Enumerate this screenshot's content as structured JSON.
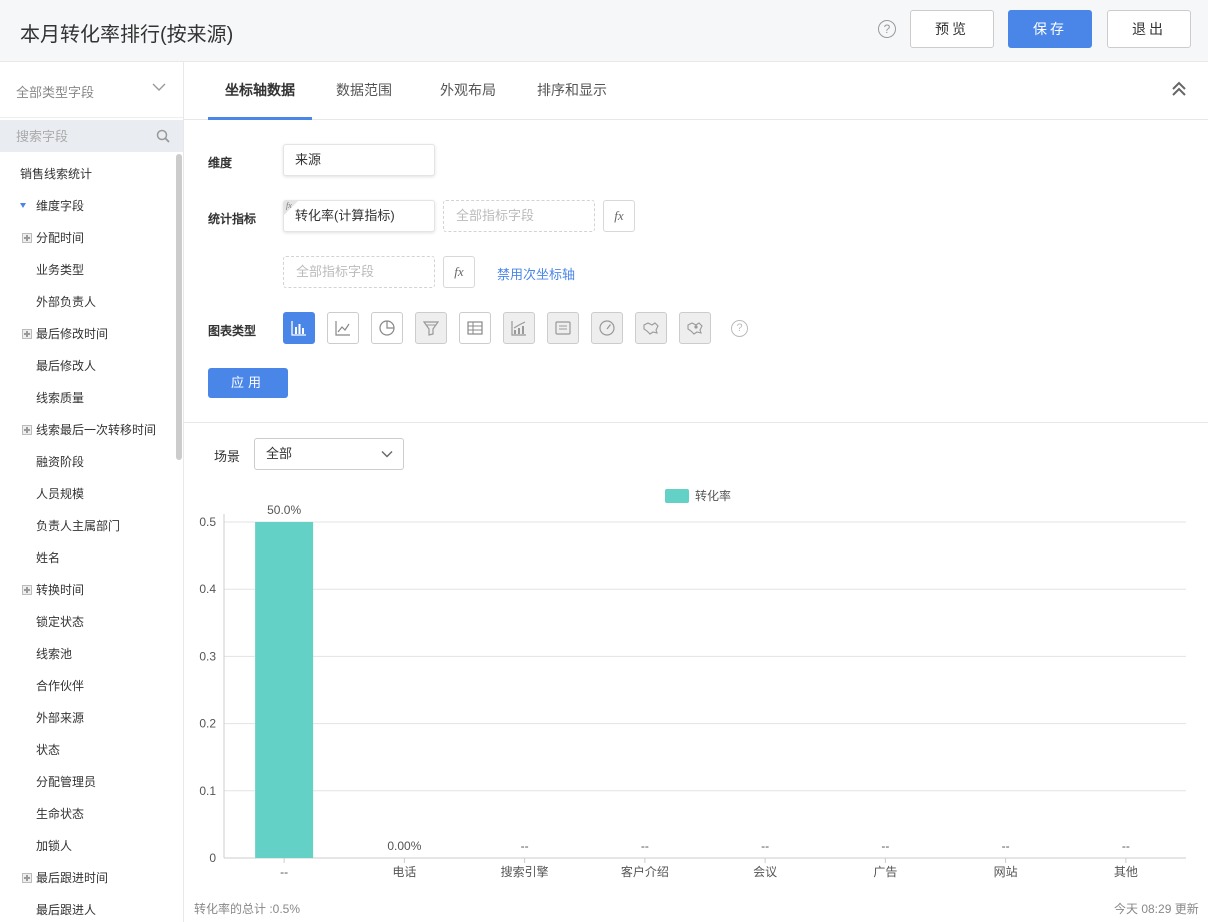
{
  "header": {
    "title": "本月转化率排行(按来源)",
    "help": "?",
    "preview_label": "预览",
    "save_label": "保存",
    "exit_label": "退出"
  },
  "sidebar": {
    "type_select": "全部类型字段",
    "search_placeholder": "搜索字段",
    "items": [
      {
        "label": "销售线索统计",
        "kind": "root"
      },
      {
        "label": "维度字段",
        "kind": "group"
      },
      {
        "label": "分配时间",
        "kind": "expandable"
      },
      {
        "label": "业务类型",
        "kind": "leaf"
      },
      {
        "label": "外部负责人",
        "kind": "leaf"
      },
      {
        "label": "最后修改时间",
        "kind": "expandable"
      },
      {
        "label": "最后修改人",
        "kind": "leaf"
      },
      {
        "label": "线索质量",
        "kind": "leaf"
      },
      {
        "label": "线索最后一次转移时间",
        "kind": "expandable"
      },
      {
        "label": "融资阶段",
        "kind": "leaf"
      },
      {
        "label": "人员规模",
        "kind": "leaf"
      },
      {
        "label": "负责人主属部门",
        "kind": "leaf"
      },
      {
        "label": "姓名",
        "kind": "leaf"
      },
      {
        "label": "转换时间",
        "kind": "expandable"
      },
      {
        "label": "锁定状态",
        "kind": "leaf"
      },
      {
        "label": "线索池",
        "kind": "leaf"
      },
      {
        "label": "合作伙伴",
        "kind": "leaf"
      },
      {
        "label": "外部来源",
        "kind": "leaf"
      },
      {
        "label": "状态",
        "kind": "leaf"
      },
      {
        "label": "分配管理员",
        "kind": "leaf"
      },
      {
        "label": "生命状态",
        "kind": "leaf"
      },
      {
        "label": "加锁人",
        "kind": "leaf"
      },
      {
        "label": "最后跟进时间",
        "kind": "expandable"
      },
      {
        "label": "最后跟进人",
        "kind": "leaf"
      }
    ]
  },
  "tabs": [
    {
      "label": "坐标轴数据",
      "active": true
    },
    {
      "label": "数据范围",
      "active": false
    },
    {
      "label": "外观布局",
      "active": false
    },
    {
      "label": "排序和显示",
      "active": false
    }
  ],
  "form": {
    "dimension_label": "维度",
    "dimension_value": "来源",
    "metric_label": "统计指标",
    "metric_value": "转化率(计算指标)",
    "metric_fx_tag": "fx",
    "metric_placeholder": "全部指标字段",
    "fx_label": "fx",
    "secondary_placeholder": "全部指标字段",
    "disable_secondary_axis": "禁用次坐标轴",
    "chart_type_label": "图表类型",
    "chart_type_help": "?",
    "chart_types": [
      {
        "icon": "bar-chart-icon",
        "state": "active"
      },
      {
        "icon": "line-chart-icon",
        "state": "normal"
      },
      {
        "icon": "pie-chart-icon",
        "state": "normal"
      },
      {
        "icon": "funnel-chart-icon",
        "state": "disabled"
      },
      {
        "icon": "table-icon",
        "state": "normal"
      },
      {
        "icon": "combo-chart-icon",
        "state": "disabled"
      },
      {
        "icon": "card-icon",
        "state": "disabled"
      },
      {
        "icon": "gauge-icon",
        "state": "disabled"
      },
      {
        "icon": "map-icon",
        "state": "disabled"
      },
      {
        "icon": "map-pin-icon",
        "state": "disabled"
      }
    ],
    "apply_label": "应用"
  },
  "scene": {
    "label": "场景",
    "value": "全部"
  },
  "chart_data": {
    "type": "bar",
    "categories": [
      "--",
      "电话",
      "搜索引擎",
      "客户介绍",
      "会议",
      "广告",
      "网站",
      "其他"
    ],
    "series": [
      {
        "name": "转化率",
        "values": [
          0.5,
          0,
          null,
          null,
          null,
          null,
          null,
          null
        ],
        "data_labels": [
          "50.0%",
          "0.00%",
          "--",
          "--",
          "--",
          "--",
          "--",
          "--"
        ],
        "color": "#63d1c5"
      }
    ],
    "y_ticks": [
      "0",
      "0.1",
      "0.2",
      "0.3",
      "0.4",
      "0.5"
    ],
    "ylim": [
      0,
      0.5
    ],
    "grid": true,
    "legend": "top-center"
  },
  "footer": {
    "total": "转化率的总计 :0.5%",
    "updated": "今天 08:29 更新"
  },
  "colors": {
    "accent": "#4a86e8",
    "bar": "#63d1c5"
  }
}
